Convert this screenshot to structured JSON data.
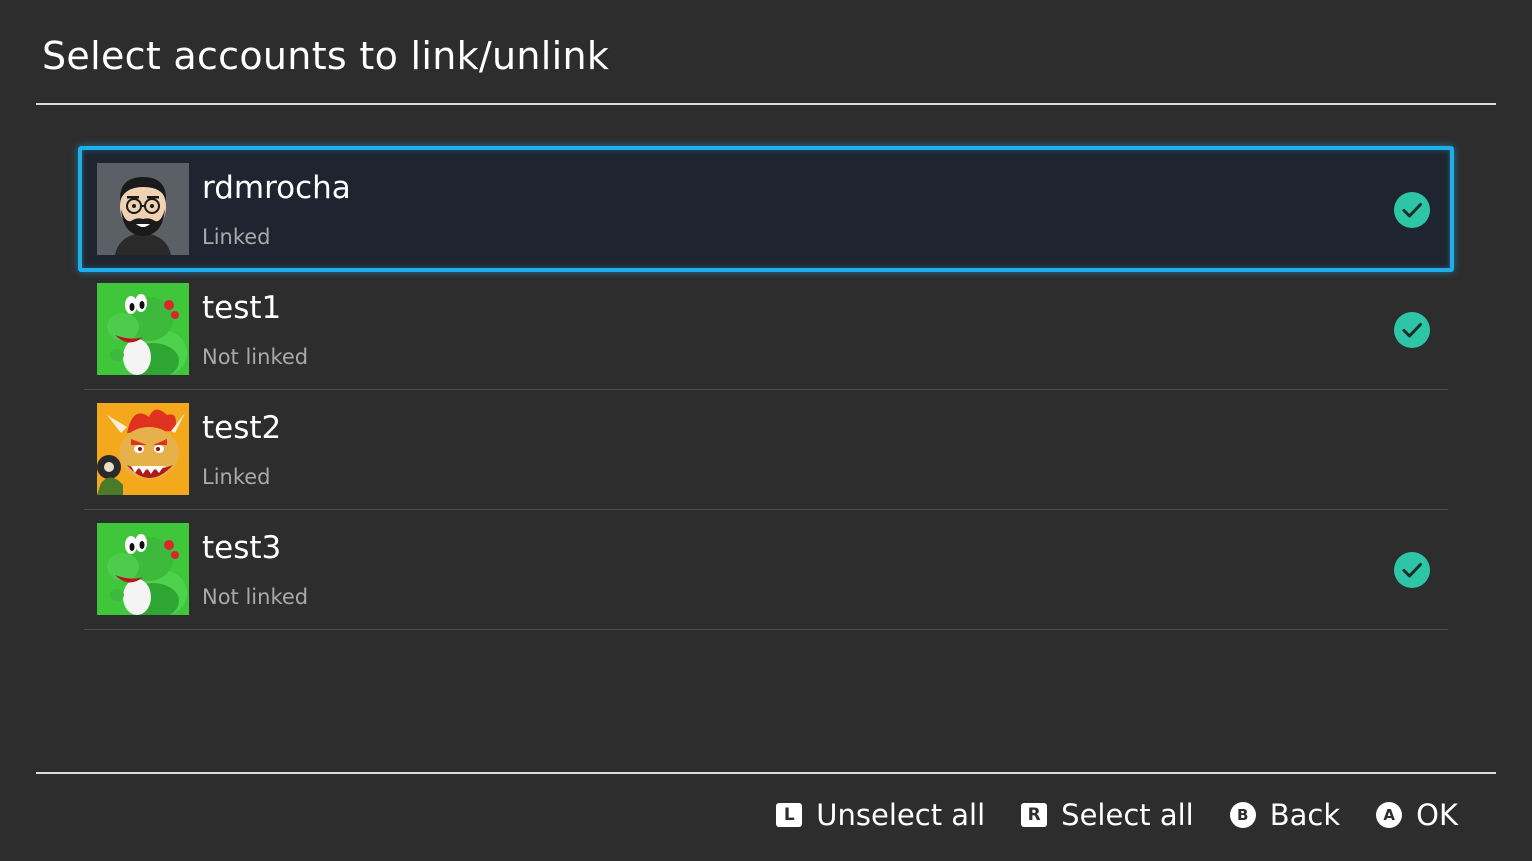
{
  "header": {
    "title": "Select accounts to link/unlink"
  },
  "accounts": [
    {
      "name": "rdmrocha",
      "status": "Linked",
      "avatar": "mii-bearded-man-avatar",
      "selected": true,
      "focused": true
    },
    {
      "name": "test1",
      "status": "Not linked",
      "avatar": "yoshi-avatar",
      "selected": true,
      "focused": false
    },
    {
      "name": "test2",
      "status": "Linked",
      "avatar": "bowser-avatar",
      "selected": false,
      "focused": false
    },
    {
      "name": "test3",
      "status": "Not linked",
      "avatar": "yoshi-avatar",
      "selected": true,
      "focused": false
    }
  ],
  "footer": {
    "unselect_all": {
      "key": "L",
      "label": "Unselect all"
    },
    "select_all": {
      "key": "R",
      "label": "Select all"
    },
    "back": {
      "key": "B",
      "label": "Back"
    },
    "ok": {
      "key": "A",
      "label": "OK"
    }
  },
  "colors": {
    "background": "#2d2d2d",
    "focus_border": "#1daeeb",
    "check": "#2cc6a6",
    "status_text": "#a9a9a9"
  }
}
